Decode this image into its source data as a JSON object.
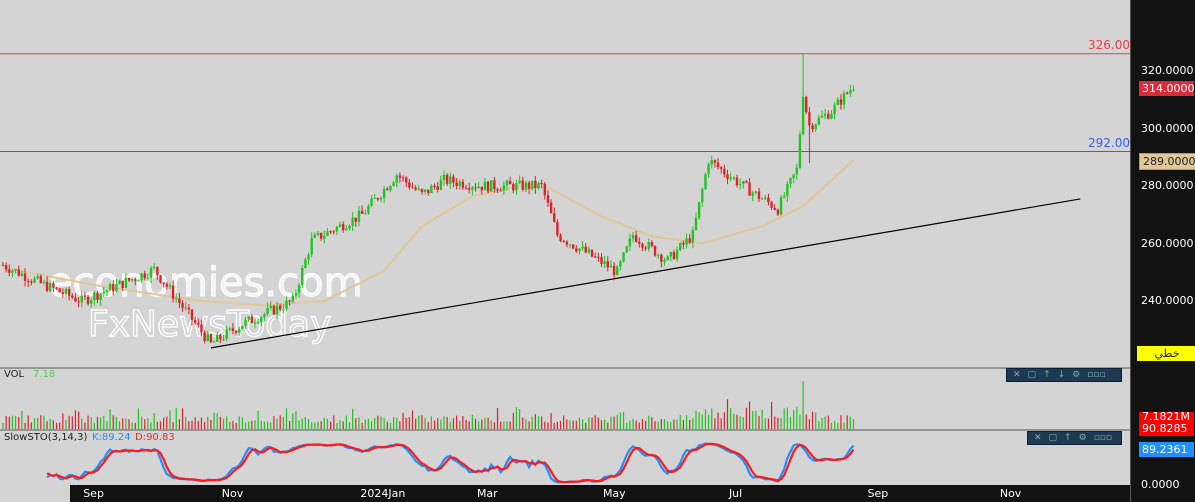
{
  "price_axis": {
    "labels": [
      "320.0000",
      "300.0000",
      "280.0000",
      "260.0000",
      "240.0000"
    ],
    "values": [
      320,
      300,
      280,
      260,
      240
    ],
    "min": 220,
    "max": 334
  },
  "current_price": {
    "label": "314.0000",
    "color": "#dc2a3a"
  },
  "ma_price": {
    "label": "289.0000",
    "color": "#e0c898"
  },
  "chart_type_button": "خطي",
  "hlines": [
    {
      "value": 326,
      "label": "326.00",
      "color": "#e8404a"
    },
    {
      "value": 292,
      "label": "292.00",
      "color": "#3a5ee8"
    }
  ],
  "trendline": {
    "from": {
      "bar": 66,
      "price": 223.7
    },
    "to": {
      "bar": 342,
      "price": 275.5
    },
    "color": "#000000"
  },
  "watermark": {
    "line1": "economies.com",
    "line2": "FxNewsToday"
  },
  "volume_panel": {
    "title": "VOL",
    "value": "7.18",
    "axis_label": "7.1821M"
  },
  "sto_panel": {
    "title": "SlowSTO(3,14,3)",
    "k_label": "K:89.24",
    "d_label": "D:90.83",
    "d_value": "90.8285",
    "k_value": "89.2361",
    "zero_label": "0.0000",
    "k_color": "#1e90ff",
    "d_color": "#ff1a1a"
  },
  "toolbar_icons": [
    "close-icon",
    "maximize-icon",
    "move-up-icon",
    "move-down-icon",
    "settings-icon",
    "more-icon"
  ],
  "x_axis": [
    {
      "label": "Sep",
      "bar": 28
    },
    {
      "label": "Nov",
      "bar": 72
    },
    {
      "label": "2024Jan",
      "bar": 116
    },
    {
      "label": "Mar",
      "bar": 153
    },
    {
      "label": "May",
      "bar": 193
    },
    {
      "label": "Jul",
      "bar": 233
    },
    {
      "label": "Sep",
      "bar": 277
    },
    {
      "label": "Nov",
      "bar": 319
    }
  ],
  "price_path": [
    [
      0,
      252.5
    ],
    [
      13,
      245.6
    ],
    [
      25,
      240
    ],
    [
      48,
      251
    ],
    [
      66,
      225
    ],
    [
      76,
      232
    ],
    [
      92,
      240
    ],
    [
      98,
      261
    ],
    [
      114,
      270
    ],
    [
      125,
      284
    ],
    [
      133,
      277
    ],
    [
      140,
      282
    ],
    [
      152,
      280
    ],
    [
      171,
      280
    ],
    [
      176,
      263
    ],
    [
      190,
      253.5
    ],
    [
      195,
      250
    ],
    [
      200,
      263
    ],
    [
      211,
      254
    ],
    [
      219,
      263
    ],
    [
      224,
      289
    ],
    [
      235,
      280
    ],
    [
      246,
      272
    ],
    [
      252,
      285.6
    ],
    [
      254,
      311.6
    ],
    [
      256,
      301
    ],
    [
      263,
      306
    ],
    [
      270,
      315
    ]
  ],
  "ma_path": [
    [
      0,
      251.5
    ],
    [
      32,
      245
    ],
    [
      63,
      240
    ],
    [
      83,
      238.5
    ],
    [
      102,
      240
    ],
    [
      121,
      250.5
    ],
    [
      133,
      266
    ],
    [
      149,
      276.5
    ],
    [
      165,
      280
    ],
    [
      173,
      279.5
    ],
    [
      190,
      269.5
    ],
    [
      206,
      262.5
    ],
    [
      222,
      260
    ],
    [
      241,
      266
    ],
    [
      254,
      273
    ],
    [
      270,
      289
    ]
  ],
  "colors": {
    "up": "#22c422",
    "down": "#e0202a"
  }
}
